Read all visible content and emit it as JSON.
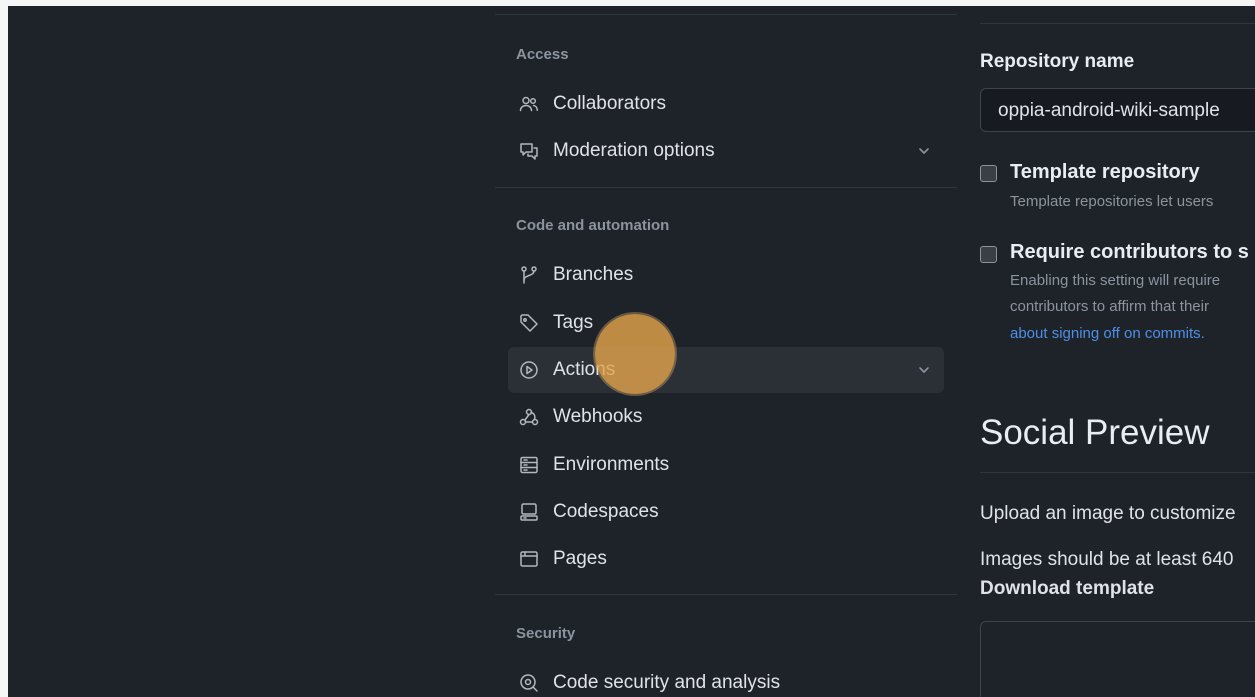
{
  "sidebar": {
    "sections": [
      {
        "title": "Access",
        "items": [
          {
            "label": "Collaborators",
            "icon": "people-icon"
          },
          {
            "label": "Moderation options",
            "icon": "comment-discussion-icon",
            "expandable": true
          }
        ]
      },
      {
        "title": "Code and automation",
        "items": [
          {
            "label": "Branches",
            "icon": "git-branch-icon"
          },
          {
            "label": "Tags",
            "icon": "tag-icon"
          },
          {
            "label": "Actions",
            "icon": "play-icon",
            "expandable": true,
            "active": true
          },
          {
            "label": "Webhooks",
            "icon": "webhook-icon"
          },
          {
            "label": "Environments",
            "icon": "server-icon"
          },
          {
            "label": "Codespaces",
            "icon": "codespaces-icon"
          },
          {
            "label": "Pages",
            "icon": "browser-icon"
          }
        ]
      },
      {
        "title": "Security",
        "items": [
          {
            "label": "Code security and analysis",
            "icon": "codescan-icon"
          }
        ]
      }
    ]
  },
  "main": {
    "repo_name_label": "Repository name",
    "repo_name_value": "oppia-android-wiki-sample",
    "template_repo": {
      "title": "Template repository",
      "desc": "Template repositories let users"
    },
    "signoff": {
      "title": "Require contributors to s",
      "desc1": "Enabling this setting will require",
      "desc2": "contributors to affirm that their",
      "link": "about signing off on commits."
    },
    "social_preview": {
      "heading": "Social Preview",
      "upload_text": "Upload an image to customize",
      "size_text": "Images should be at least 640",
      "download_link": "Download template"
    }
  },
  "colors": {
    "background": "#1e232a",
    "accent_link": "#4d8fe6",
    "active_item": "#2b3037",
    "click_marker": "#e0a24a"
  }
}
